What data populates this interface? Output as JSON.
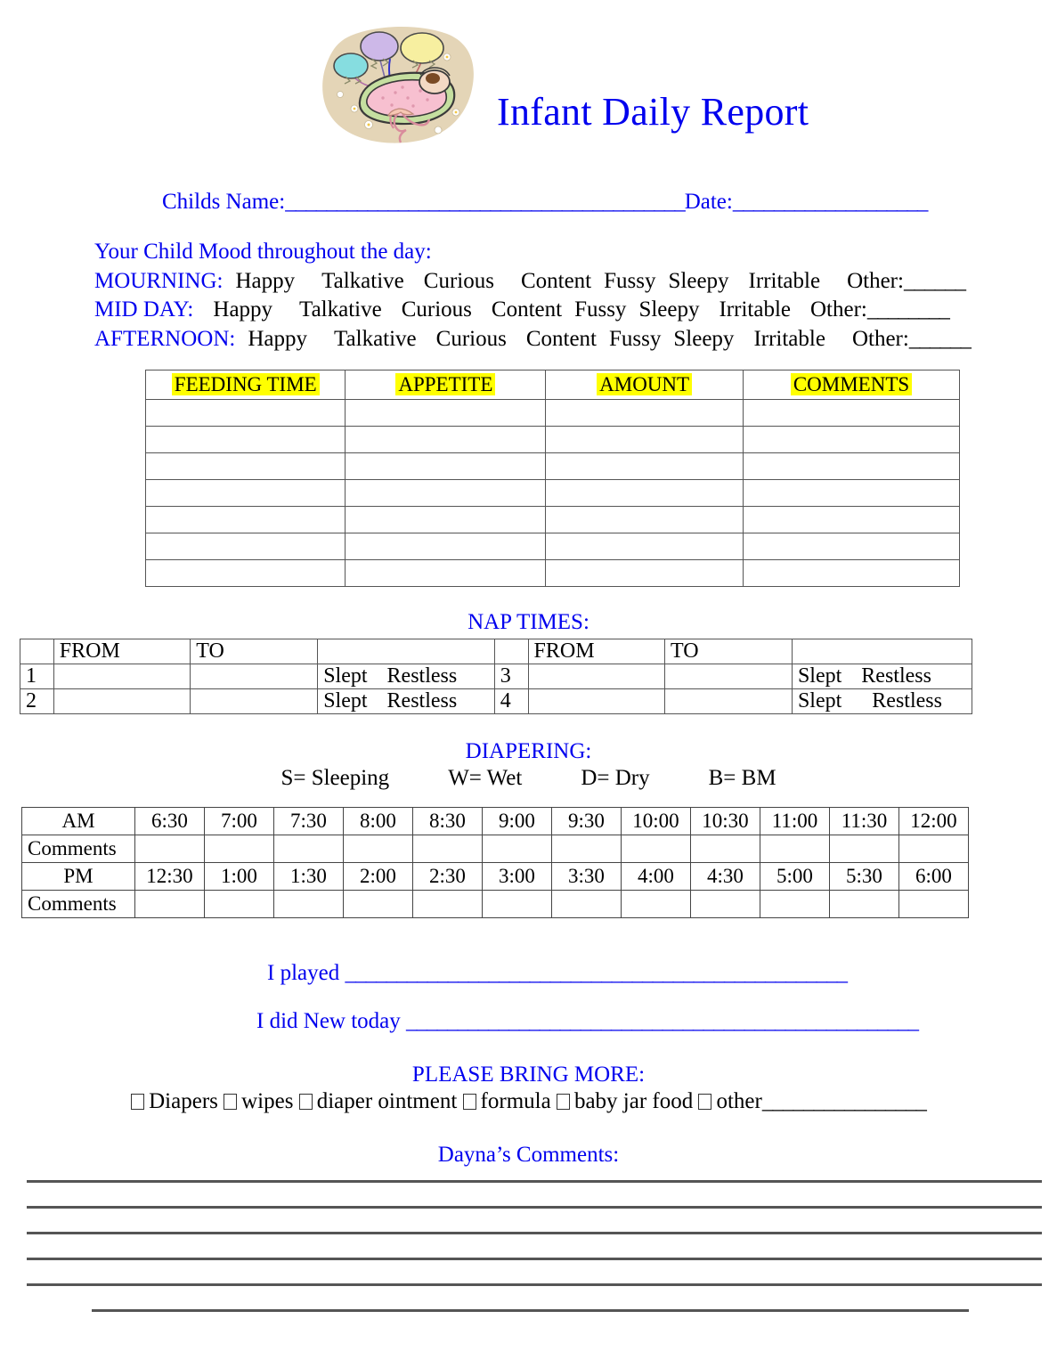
{
  "document": {
    "title": "Infant Daily Report",
    "accent_color": "#0000EE",
    "highlight_color": "#FFFF00"
  },
  "clipart": {
    "name": "baby-in-bassinet-with-balloons",
    "background_color": "#E4D5B7",
    "balloon_colors": [
      "#CDB8E8",
      "#F7EFA0",
      "#86DDE0"
    ],
    "bassinet_color": "#C5DFA0",
    "blanket_color": "#F7C0D0"
  },
  "identity": {
    "child_name_label": "Childs Name:",
    "child_name_rule": "_______________________________________",
    "date_label": "Date:",
    "date_rule": "___________________"
  },
  "mood": {
    "heading": "Your Child Mood throughout the day:",
    "options": [
      "Happy",
      "Talkative",
      "Curious",
      "Content",
      "Fussy",
      "Sleepy",
      "Irritable"
    ],
    "other_label": "Other:",
    "rows": [
      {
        "label": "MOURNING:",
        "other_rule": "______"
      },
      {
        "label": "MID DAY:",
        "other_rule": "________"
      },
      {
        "label": "AFTERNOON:",
        "other_rule": "______"
      }
    ]
  },
  "feeding": {
    "headers": [
      "FEEDING TIME",
      "APPETITE",
      "AMOUNT",
      "COMMENTS"
    ],
    "empty_row_count": 7
  },
  "naps": {
    "title": "NAP TIMES:",
    "col_from": "FROM",
    "col_to": "TO",
    "slept": "Slept",
    "restless": "Restless",
    "rows": [
      {
        "left_num": "1",
        "right_num": "3"
      },
      {
        "left_num": "2",
        "right_num": "4"
      }
    ]
  },
  "diapering": {
    "title": "DIAPERING:",
    "legend": [
      "S= Sleeping",
      "W=  Wet",
      "D= Dry",
      "B= BM"
    ],
    "am_label": "AM",
    "pm_label": "PM",
    "comments_label": "Comments",
    "am_times": [
      "6:30",
      "7:00",
      "7:30",
      "8:00",
      "8:30",
      "9:00",
      "9:30",
      "10:00",
      "10:30",
      "11:00",
      "11:30",
      "12:00"
    ],
    "pm_times": [
      "12:30",
      "1:00",
      "1:30",
      "2:00",
      "2:30",
      "3:00",
      "3:30",
      "4:00",
      "4:30",
      "5:00",
      "5:30",
      "6:00"
    ]
  },
  "activities": {
    "played_label": "I played",
    "played_rule": "_________________________________________________",
    "new_label": "I did New today",
    "new_rule": "__________________________________________________"
  },
  "bring_more": {
    "title": "PLEASE BRING MORE:",
    "items": [
      "Diapers",
      "wipes",
      "diaper ointment",
      "formula",
      "baby jar food",
      "other"
    ],
    "other_rule": "________________"
  },
  "caregiver_comments": {
    "title": "Dayna’s Comments:",
    "line_count": 6
  }
}
